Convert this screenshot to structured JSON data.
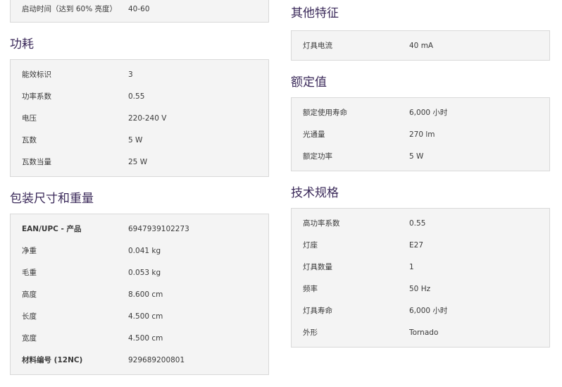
{
  "left": {
    "startup": {
      "rows": [
        {
          "label": "启动时间（达到 60% 亮度）",
          "value": "40-60"
        }
      ]
    },
    "power": {
      "title": "功耗",
      "rows": [
        {
          "label": "能效标识",
          "value": "3"
        },
        {
          "label": "功率系数",
          "value": "0.55"
        },
        {
          "label": "电压",
          "value": "220-240 V"
        },
        {
          "label": "瓦数",
          "value": "5 W"
        },
        {
          "label": "瓦数当量",
          "value": "25 W"
        }
      ]
    },
    "packaging": {
      "title": "包装尺寸和重量",
      "rows": [
        {
          "label": "EAN/UPC - 产品",
          "value": "6947939102273"
        },
        {
          "label": "净重",
          "value": "0.041 kg"
        },
        {
          "label": "毛重",
          "value": "0.053 kg"
        },
        {
          "label": "高度",
          "value": "8.600 cm"
        },
        {
          "label": "长度",
          "value": "4.500 cm"
        },
        {
          "label": "宽度",
          "value": "4.500 cm"
        },
        {
          "label": "材料编号 (12NC)",
          "value": "929689200801"
        }
      ]
    }
  },
  "right": {
    "other": {
      "title": "其他特征",
      "rows": [
        {
          "label": "灯具电流",
          "value": "40 mA"
        }
      ]
    },
    "rated": {
      "title": "额定值",
      "rows": [
        {
          "label": "额定使用寿命",
          "value": "6,000 小时"
        },
        {
          "label": "光通量",
          "value": "270 lm"
        },
        {
          "label": "额定功率",
          "value": "5 W"
        }
      ]
    },
    "tech": {
      "title": "技术规格",
      "rows": [
        {
          "label": "高功率系数",
          "value": "0.55"
        },
        {
          "label": "灯座",
          "value": "E27"
        },
        {
          "label": "灯具数量",
          "value": "1"
        },
        {
          "label": "频率",
          "value": "50 Hz"
        },
        {
          "label": "灯具寿命",
          "value": "6,000 小时"
        },
        {
          "label": "外形",
          "value": "Tornado"
        }
      ]
    }
  }
}
